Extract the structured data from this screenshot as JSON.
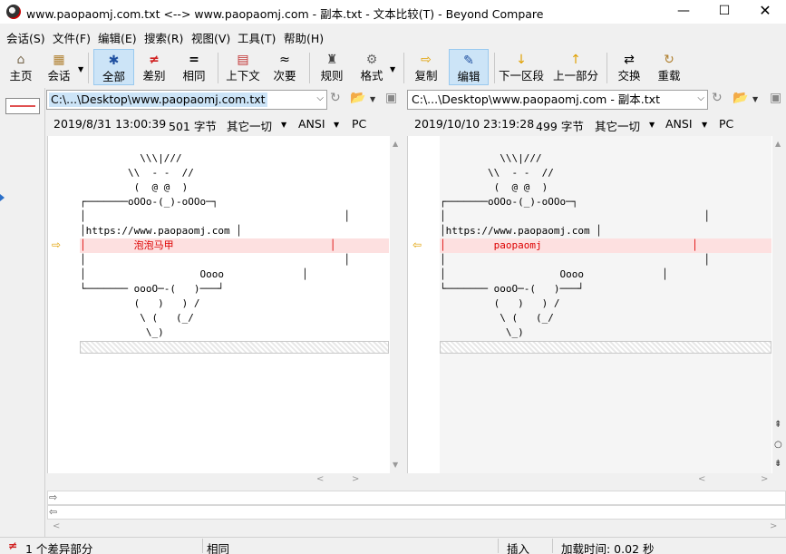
{
  "window": {
    "title": "www.paopaomj.com.txt <--> www.paopaomj.com - 副本.txt - 文本比较(T) - Beyond Compare",
    "minimize": "—",
    "maximize": "☐",
    "close": "✕"
  },
  "menu": [
    "会话(S)",
    "文件(F)",
    "编辑(E)",
    "搜索(R)",
    "视图(V)",
    "工具(T)",
    "帮助(H)"
  ],
  "toolbar": {
    "home": {
      "label": "主页",
      "icon": "⌂"
    },
    "session": {
      "label": "会话",
      "icon": "▦"
    },
    "all": {
      "label": "全部",
      "icon": "✱"
    },
    "diffs": {
      "label": "差别",
      "icon": "≠"
    },
    "same": {
      "label": "相同",
      "icon": "="
    },
    "context": {
      "label": "上下文",
      "icon": "▤"
    },
    "minor": {
      "label": "次要",
      "icon": "≈"
    },
    "rules": {
      "label": "规则",
      "icon": "♜"
    },
    "format": {
      "label": "格式",
      "icon": "⚙"
    },
    "copy": {
      "label": "复制",
      "icon": "⇨"
    },
    "edit": {
      "label": "编辑",
      "icon": "✎"
    },
    "next_section": {
      "label": "下一区段",
      "icon": "↓"
    },
    "prev_section": {
      "label": "上一部分",
      "icon": "↑"
    },
    "swap": {
      "label": "交换",
      "icon": "⇄"
    },
    "reload": {
      "label": "重载",
      "icon": "↻"
    }
  },
  "left": {
    "path": "C:\\...\\Desktop\\www.paopaomj.com.txt",
    "date": "2019/8/31 13:00:39",
    "size": "501 字节",
    "other": "其它一切",
    "encoding": "ANSI",
    "lineend": "PC",
    "lines": [
      "          \\\\\\|///",
      "        \\\\  - -  //",
      "         (  @ @  )",
      "┌───────oOOo-(_)-oOOo─┐",
      "│                                           │",
      "│https://www.paopaomj.com │",
      "│        泡泡马甲                          │",
      "│                                           │",
      "│                   Oooo             │",
      "└─────── oooO─-(   )───┘",
      "         (   )   ) /",
      "          \\ (   (_/",
      "           \\_)"
    ]
  },
  "right": {
    "path": "C:\\...\\Desktop\\www.paopaomj.com - 副本.txt",
    "date": "2019/10/10 23:19:28",
    "size": "499 字节",
    "other": "其它一切",
    "encoding": "ANSI",
    "lineend": "PC",
    "lines": [
      "          \\\\\\|///",
      "        \\\\  - -  //",
      "         (  @ @  )",
      "┌───────oOOo-(_)-oOOo─┐",
      "│                                           │",
      "│https://www.paopaomj.com │",
      "│        paopaomj                         │",
      "│                                           │",
      "│                   Oooo             │",
      "└─────── oooO─-(   )───┘",
      "         (   )   ) /",
      "          \\ (   (_/",
      "           \\_)"
    ]
  },
  "status": {
    "diff_count": "1 个差异部分",
    "state": "相同",
    "mode": "插入",
    "load_time": "加载时间:  0.02 秒"
  }
}
